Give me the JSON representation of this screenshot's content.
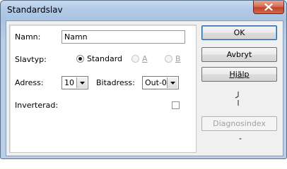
{
  "window": {
    "title": "Standardslav",
    "close_icon": "close-icon"
  },
  "form": {
    "name_label": "Namn:",
    "name_value": "Namn",
    "slavetype_label": "Slavtyp:",
    "radio_standard": "Standard",
    "radio_a": "A",
    "radio_b": "B",
    "address_label": "Adress:",
    "address_value": "10",
    "bitaddress_label": "Bitadress:",
    "bitaddress_value": "Out-0",
    "inverted_label": "Inverterad:"
  },
  "buttons": {
    "ok": "OK",
    "cancel": "Avbryt",
    "help": "Hjälp",
    "diag": "Diagnosindex"
  },
  "diag_value": "-"
}
